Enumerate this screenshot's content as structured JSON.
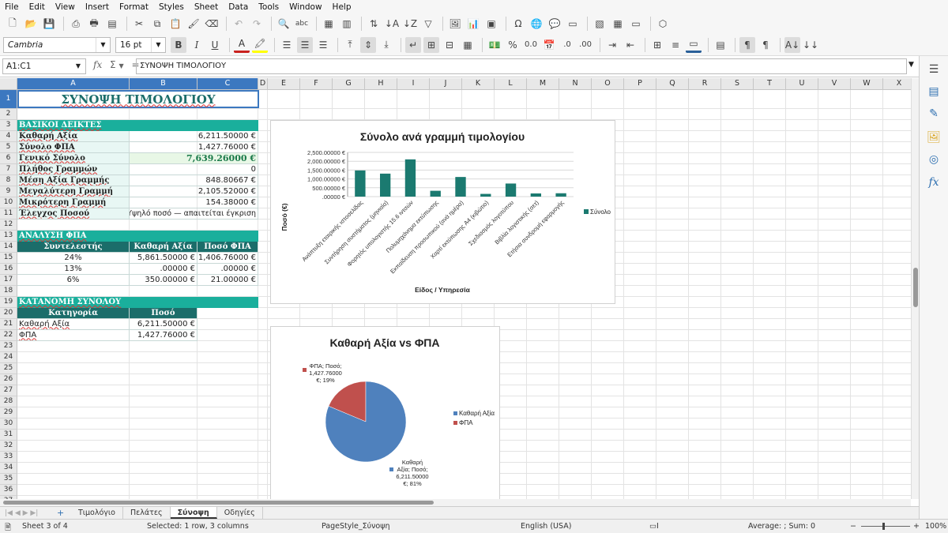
{
  "menu": [
    "File",
    "Edit",
    "View",
    "Insert",
    "Format",
    "Styles",
    "Sheet",
    "Data",
    "Tools",
    "Window",
    "Help"
  ],
  "toolbar": {
    "font_name": "Cambria",
    "font_size": "16 pt"
  },
  "formula_bar": {
    "name_box": "A1:C1",
    "content": "ΣΥΝΟΨΗ ΤΙΜΟΛΟΓΙΟΥ"
  },
  "columns": [
    "A",
    "B",
    "C",
    "D",
    "E",
    "F",
    "G",
    "H",
    "I",
    "J",
    "K",
    "L",
    "M",
    "N",
    "O",
    "P",
    "Q",
    "R",
    "S",
    "T",
    "U",
    "V",
    "W",
    "X"
  ],
  "rows": [
    "1",
    "2",
    "3",
    "4",
    "5",
    "6",
    "7",
    "8",
    "9",
    "10",
    "11",
    "12",
    "13",
    "14",
    "15",
    "16",
    "17",
    "18",
    "19",
    "20",
    "21",
    "22",
    "23",
    "24",
    "25",
    "26",
    "27",
    "28",
    "29",
    "30",
    "31",
    "32",
    "33",
    "34",
    "35",
    "36",
    "37"
  ],
  "sheet": {
    "title": "ΣΥΝΟΨΗ ΤΙΜΟΛΟΓΙΟΥ",
    "kpi_header": "ΒΑΣΙΚΟΙ ΔΕΙΚΤΕΣ",
    "kpis": [
      {
        "label": "Καθαρή Αξία",
        "value": "6,211.50000 €"
      },
      {
        "label": "Σύνολο ΦΠΑ",
        "value": "1,427.76000 €"
      },
      {
        "label": "Γενικό Σύνολο",
        "value": "7,639.26000 €"
      },
      {
        "label": "Πλήθος Γραμμών",
        "value": "0"
      },
      {
        "label": "Μέση Αξία Γραμμής",
        "value": "848.80667 €"
      },
      {
        "label": "Μεγαλύτερη Γραμμή",
        "value": "2,105.52000 €"
      },
      {
        "label": "Μικρότερη Γραμμή",
        "value": "154.38000 €"
      },
      {
        "label": "Έλεγχος Ποσού",
        "value": "Υψηλό ποσό — απαιτείται έγκριση"
      }
    ],
    "vat_header": "ΑΝΑΛΥΣΗ ΦΠΑ",
    "vat_columns": [
      "Συντελεστής",
      "Καθαρή Αξία",
      "Ποσό ΦΠΑ"
    ],
    "vat_rows": [
      [
        "24%",
        "5,861.50000 €",
        "1,406.76000 €"
      ],
      [
        "13%",
        ".00000 €",
        ".00000 €"
      ],
      [
        "6%",
        "350.00000 €",
        "21.00000 €"
      ]
    ],
    "dist_header": "ΚΑΤΑΝΟΜΗ ΣΥΝΟΛΟΥ",
    "dist_columns": [
      "Κατηγορία",
      "Ποσό"
    ],
    "dist_rows": [
      [
        "Καθαρή Αξία",
        "6,211.50000 €"
      ],
      [
        "ΦΠΑ",
        "1,427.76000 €"
      ]
    ]
  },
  "chart_data": [
    {
      "type": "bar",
      "title": "Σύνολο ανά γραμμή τιμολογίου",
      "xlabel": "Είδος / Υπηρεσία",
      "ylabel": "Ποσό (€)",
      "ylim": [
        0,
        2500
      ],
      "yticks": [
        "2,500.00000 €",
        "2,000.00000 €",
        "1,500.00000 €",
        "1,000.00000 €",
        "500.00000 €",
        ".00000 €"
      ],
      "categories": [
        "Ανάπτυξη εταιρικής ιστοσελίδας",
        "Συντήρηση συστήματος (μηνιαία)",
        "Φορητός υπολογιστής 15.6 ιντσών",
        "Πολυμηχάνημα εκτύπωσης",
        "Εκπαίδευση προσωπικού (ανά ημέρα)",
        "Χαρτί εκτύπωσης A4 (κιβώτιο)",
        "Σχεδιασμός λογοτύπου",
        "Βιβλία λογιστικής (σετ)",
        "Ετήσια συνδρομή εφαρμογής"
      ],
      "series": [
        {
          "name": "Σύνολο",
          "values": [
            1480,
            1300,
            2105.52,
            330,
            1110,
            154.38,
            740,
            180,
            190
          ]
        }
      ],
      "legend": "right",
      "color": "#1b7a70"
    },
    {
      "type": "pie",
      "title": "Καθαρή Αξία vs ΦΠΑ",
      "slices": [
        {
          "name": "Καθαρή Αξία",
          "value": 6211.5,
          "color": "#4f81bd",
          "label_lines": [
            "Καθαρή",
            "Αξία; Ποσό;",
            "6,211.50000",
            "€; 81%"
          ]
        },
        {
          "name": "ΦΠΑ",
          "value": 1427.76,
          "color": "#c0504d",
          "label_lines": [
            "ΦΠΑ; Ποσό;",
            "1,427.76000",
            "€; 19%"
          ]
        }
      ],
      "legend": "right"
    }
  ],
  "sheet_tabs": [
    "Τιμολόγιο",
    "Πελάτες",
    "Σύνοψη",
    "Οδηγίες"
  ],
  "active_tab": "Σύνοψη",
  "status": {
    "sheet": "Sheet 3 of 4",
    "selection": "Selected: 1 row, 3 columns",
    "page_style": "PageStyle_Σύνοψη",
    "language": "English (USA)",
    "summary": "Average: ; Sum: 0",
    "zoom": "100%"
  }
}
